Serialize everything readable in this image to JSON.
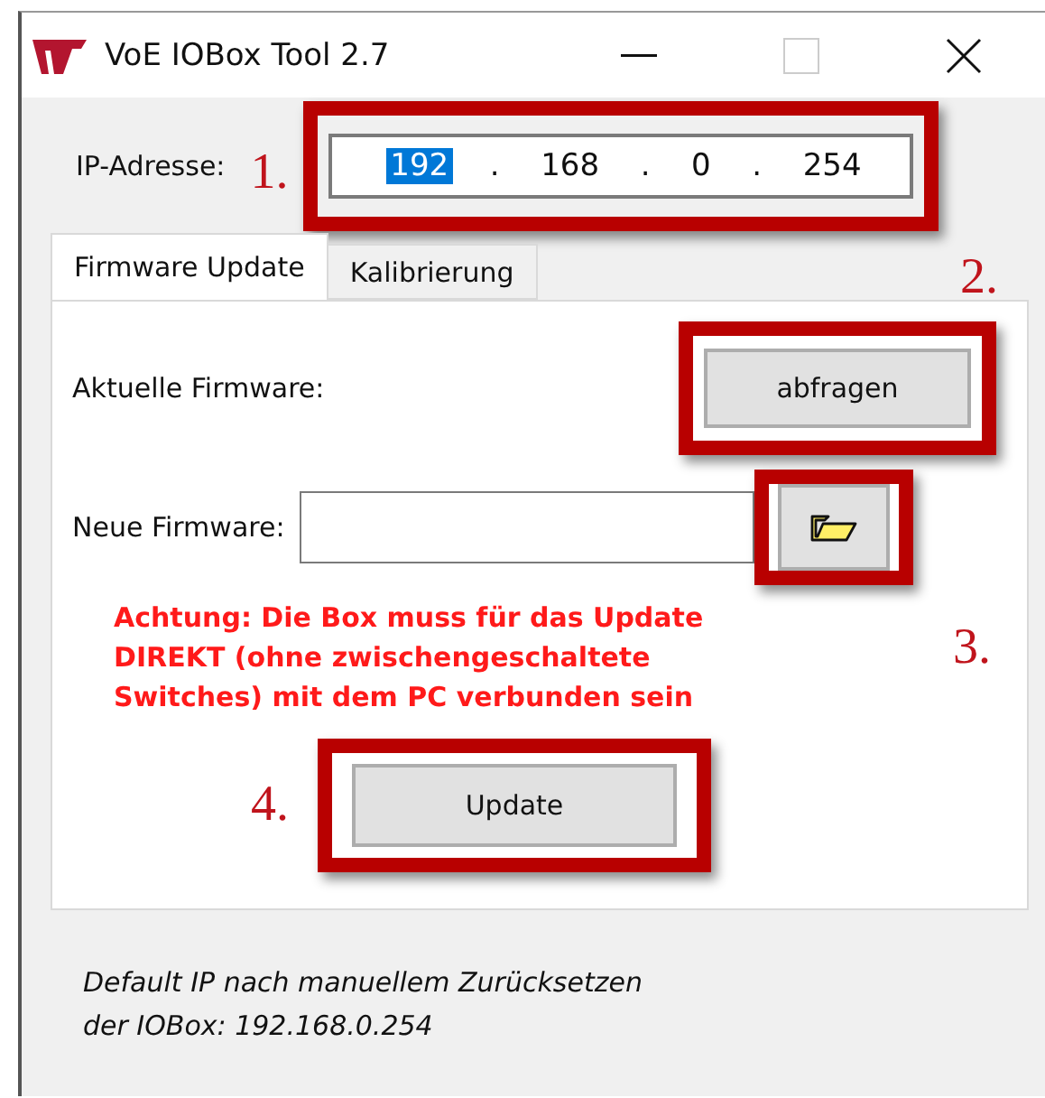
{
  "window": {
    "title": "VoE IOBox Tool 2.7"
  },
  "ip": {
    "label": "IP-Adresse:",
    "octets": [
      {
        "value": "192",
        "selected": true
      },
      {
        "value": "168",
        "selected": false
      },
      {
        "value": "0",
        "selected": false
      },
      {
        "value": "254",
        "selected": false
      }
    ],
    "separators": [
      ".",
      ".",
      "."
    ]
  },
  "tabs": [
    {
      "label": "Firmware Update",
      "selected": true
    },
    {
      "label": "Kalibrierung",
      "selected": false
    }
  ],
  "current_firmware": {
    "label": "Aktuelle Firmware:",
    "button": "abfragen"
  },
  "new_firmware": {
    "label": "Neue Firmware:"
  },
  "warning": [
    "Achtung: Die Box muss für das Update",
    "DIREKT (ohne zwischengeschaltete",
    "Switches) mit dem PC verbunden sein"
  ],
  "update_button": "Update",
  "note": [
    "Default IP nach manuellem Zurücksetzen",
    "der IOBox: 192.168.0.254"
  ],
  "annotations": [
    "1.",
    "2.",
    "3.",
    "4."
  ]
}
